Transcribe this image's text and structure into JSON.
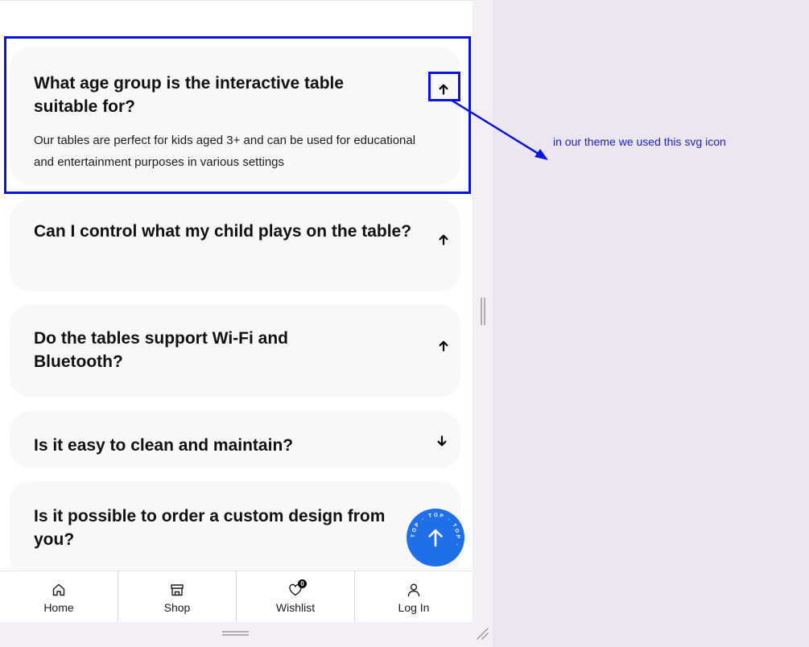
{
  "faq": {
    "items": [
      {
        "question": "What age group is the interactive table suitable for?",
        "answer": "Our tables are perfect for kids aged 3+ and can be used for educational and entertainment purposes in various settings",
        "expanded": true,
        "toggle_icon": "arrow-up-icon"
      },
      {
        "question": "Can I control what my child plays on the table?",
        "expanded": false,
        "toggle_icon": "arrow-up-icon"
      },
      {
        "question": "Do the tables support Wi-Fi and Bluetooth?",
        "expanded": false,
        "toggle_icon": "arrow-up-icon"
      },
      {
        "question": "Is it easy to clean and maintain?",
        "expanded": false,
        "toggle_icon": "arrow-down-icon"
      },
      {
        "question": "Is it possible to order a custom design from you?",
        "expanded": false,
        "toggle_icon": "arrow-up-icon"
      }
    ]
  },
  "annotation": {
    "note": "in our theme we used this svg icon",
    "color": "#0a14e0"
  },
  "scroll_top": {
    "ring_text": "TOP · TOP · TOP ·",
    "icon": "arrow-up-icon",
    "color": "#1f6fe9"
  },
  "bottom_nav": {
    "items": [
      {
        "label": "Home",
        "icon": "home-icon"
      },
      {
        "label": "Shop",
        "icon": "shop-icon"
      },
      {
        "label": "Wishlist",
        "icon": "heart-icon",
        "badge": "0"
      },
      {
        "label": "Log In",
        "icon": "user-icon"
      }
    ]
  }
}
